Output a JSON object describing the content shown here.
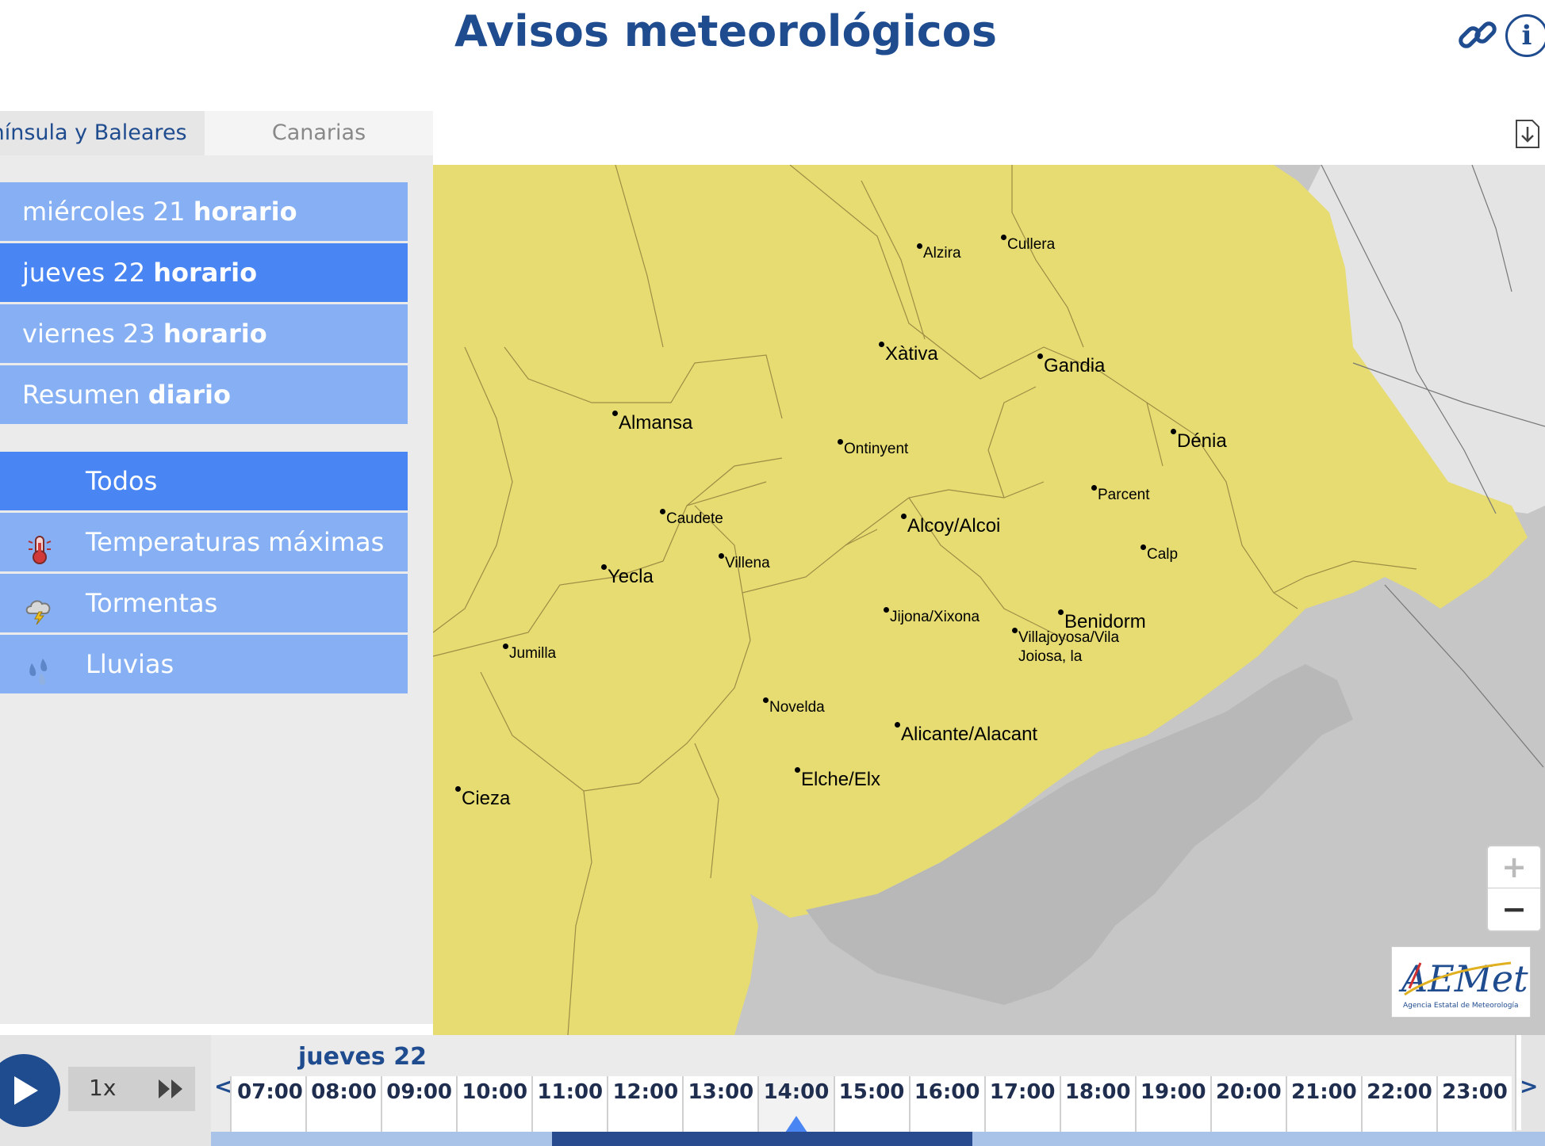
{
  "header": {
    "title": "Avisos meteorológicos",
    "link_icon": "link-icon",
    "info_icon": "info-icon",
    "info_glyph": "i"
  },
  "region_tabs": [
    {
      "label": "Península y Baleares",
      "visible_label": "enínsula y Baleares",
      "active": true
    },
    {
      "label": "Canarias",
      "active": false
    }
  ],
  "download_icon": "download-icon",
  "days_menu": [
    {
      "day": "miércoles 21",
      "mode": "horario",
      "active": false
    },
    {
      "day": "jueves 22",
      "mode": "horario",
      "active": true
    },
    {
      "day": "viernes 23",
      "mode": "horario",
      "active": false
    },
    {
      "day": "Resumen",
      "mode": "diario",
      "active": false
    }
  ],
  "filters": [
    {
      "label": "Todos",
      "icon": "",
      "active": true
    },
    {
      "label": "Temperaturas máximas",
      "icon": "thermometer-icon",
      "active": false
    },
    {
      "label": "Tormentas",
      "icon": "storm-icon",
      "active": false
    },
    {
      "label": "Lluvias",
      "icon": "rain-icon",
      "active": false
    }
  ],
  "map": {
    "warning_color": "#e6dc72",
    "no_warning_color": "#c6c6c6",
    "cities": [
      {
        "name": "Alzira",
        "size": "small"
      },
      {
        "name": "Cullera",
        "size": "small"
      },
      {
        "name": "Xàtiva",
        "size": "big"
      },
      {
        "name": "Gandia",
        "size": "big"
      },
      {
        "name": "Almansa",
        "size": "big"
      },
      {
        "name": "Ontinyent",
        "size": "small"
      },
      {
        "name": "Dénia",
        "size": "big"
      },
      {
        "name": "Parcent",
        "size": "small"
      },
      {
        "name": "Caudete",
        "size": "small"
      },
      {
        "name": "Alcoy/Alcoi",
        "size": "big"
      },
      {
        "name": "Calp",
        "size": "small"
      },
      {
        "name": "Villena",
        "size": "small"
      },
      {
        "name": "Yecla",
        "size": "big"
      },
      {
        "name": "Jijona/Xixona",
        "size": "small"
      },
      {
        "name": "Benidorm",
        "size": "big"
      },
      {
        "name": "Villajoyosa/Vila",
        "size": "small"
      },
      {
        "name": "Joiosa, la",
        "size": "small"
      },
      {
        "name": "Jumilla",
        "size": "small"
      },
      {
        "name": "Novelda",
        "size": "small"
      },
      {
        "name": "Alicante/Alacant",
        "size": "big"
      },
      {
        "name": "Elche/Elx",
        "size": "big"
      },
      {
        "name": "Cieza",
        "size": "big"
      }
    ],
    "zoom_in": "+",
    "zoom_out": "−",
    "logo_text": "AEMet",
    "logo_subtext": "Agencia Estatal de Meteorología"
  },
  "timeline": {
    "play_icon": "play-icon",
    "speed": "1x",
    "fast_forward_icon": "fast-forward-icon",
    "day_label": "jueves 22",
    "prev_arrow": "<",
    "next_arrow": ">",
    "hours": [
      "07:00",
      "08:00",
      "09:00",
      "10:00",
      "11:00",
      "12:00",
      "13:00",
      "14:00",
      "15:00",
      "16:00",
      "17:00",
      "18:00",
      "19:00",
      "20:00",
      "21:00",
      "22:00",
      "23:00"
    ],
    "selected_hour": "14:00"
  }
}
